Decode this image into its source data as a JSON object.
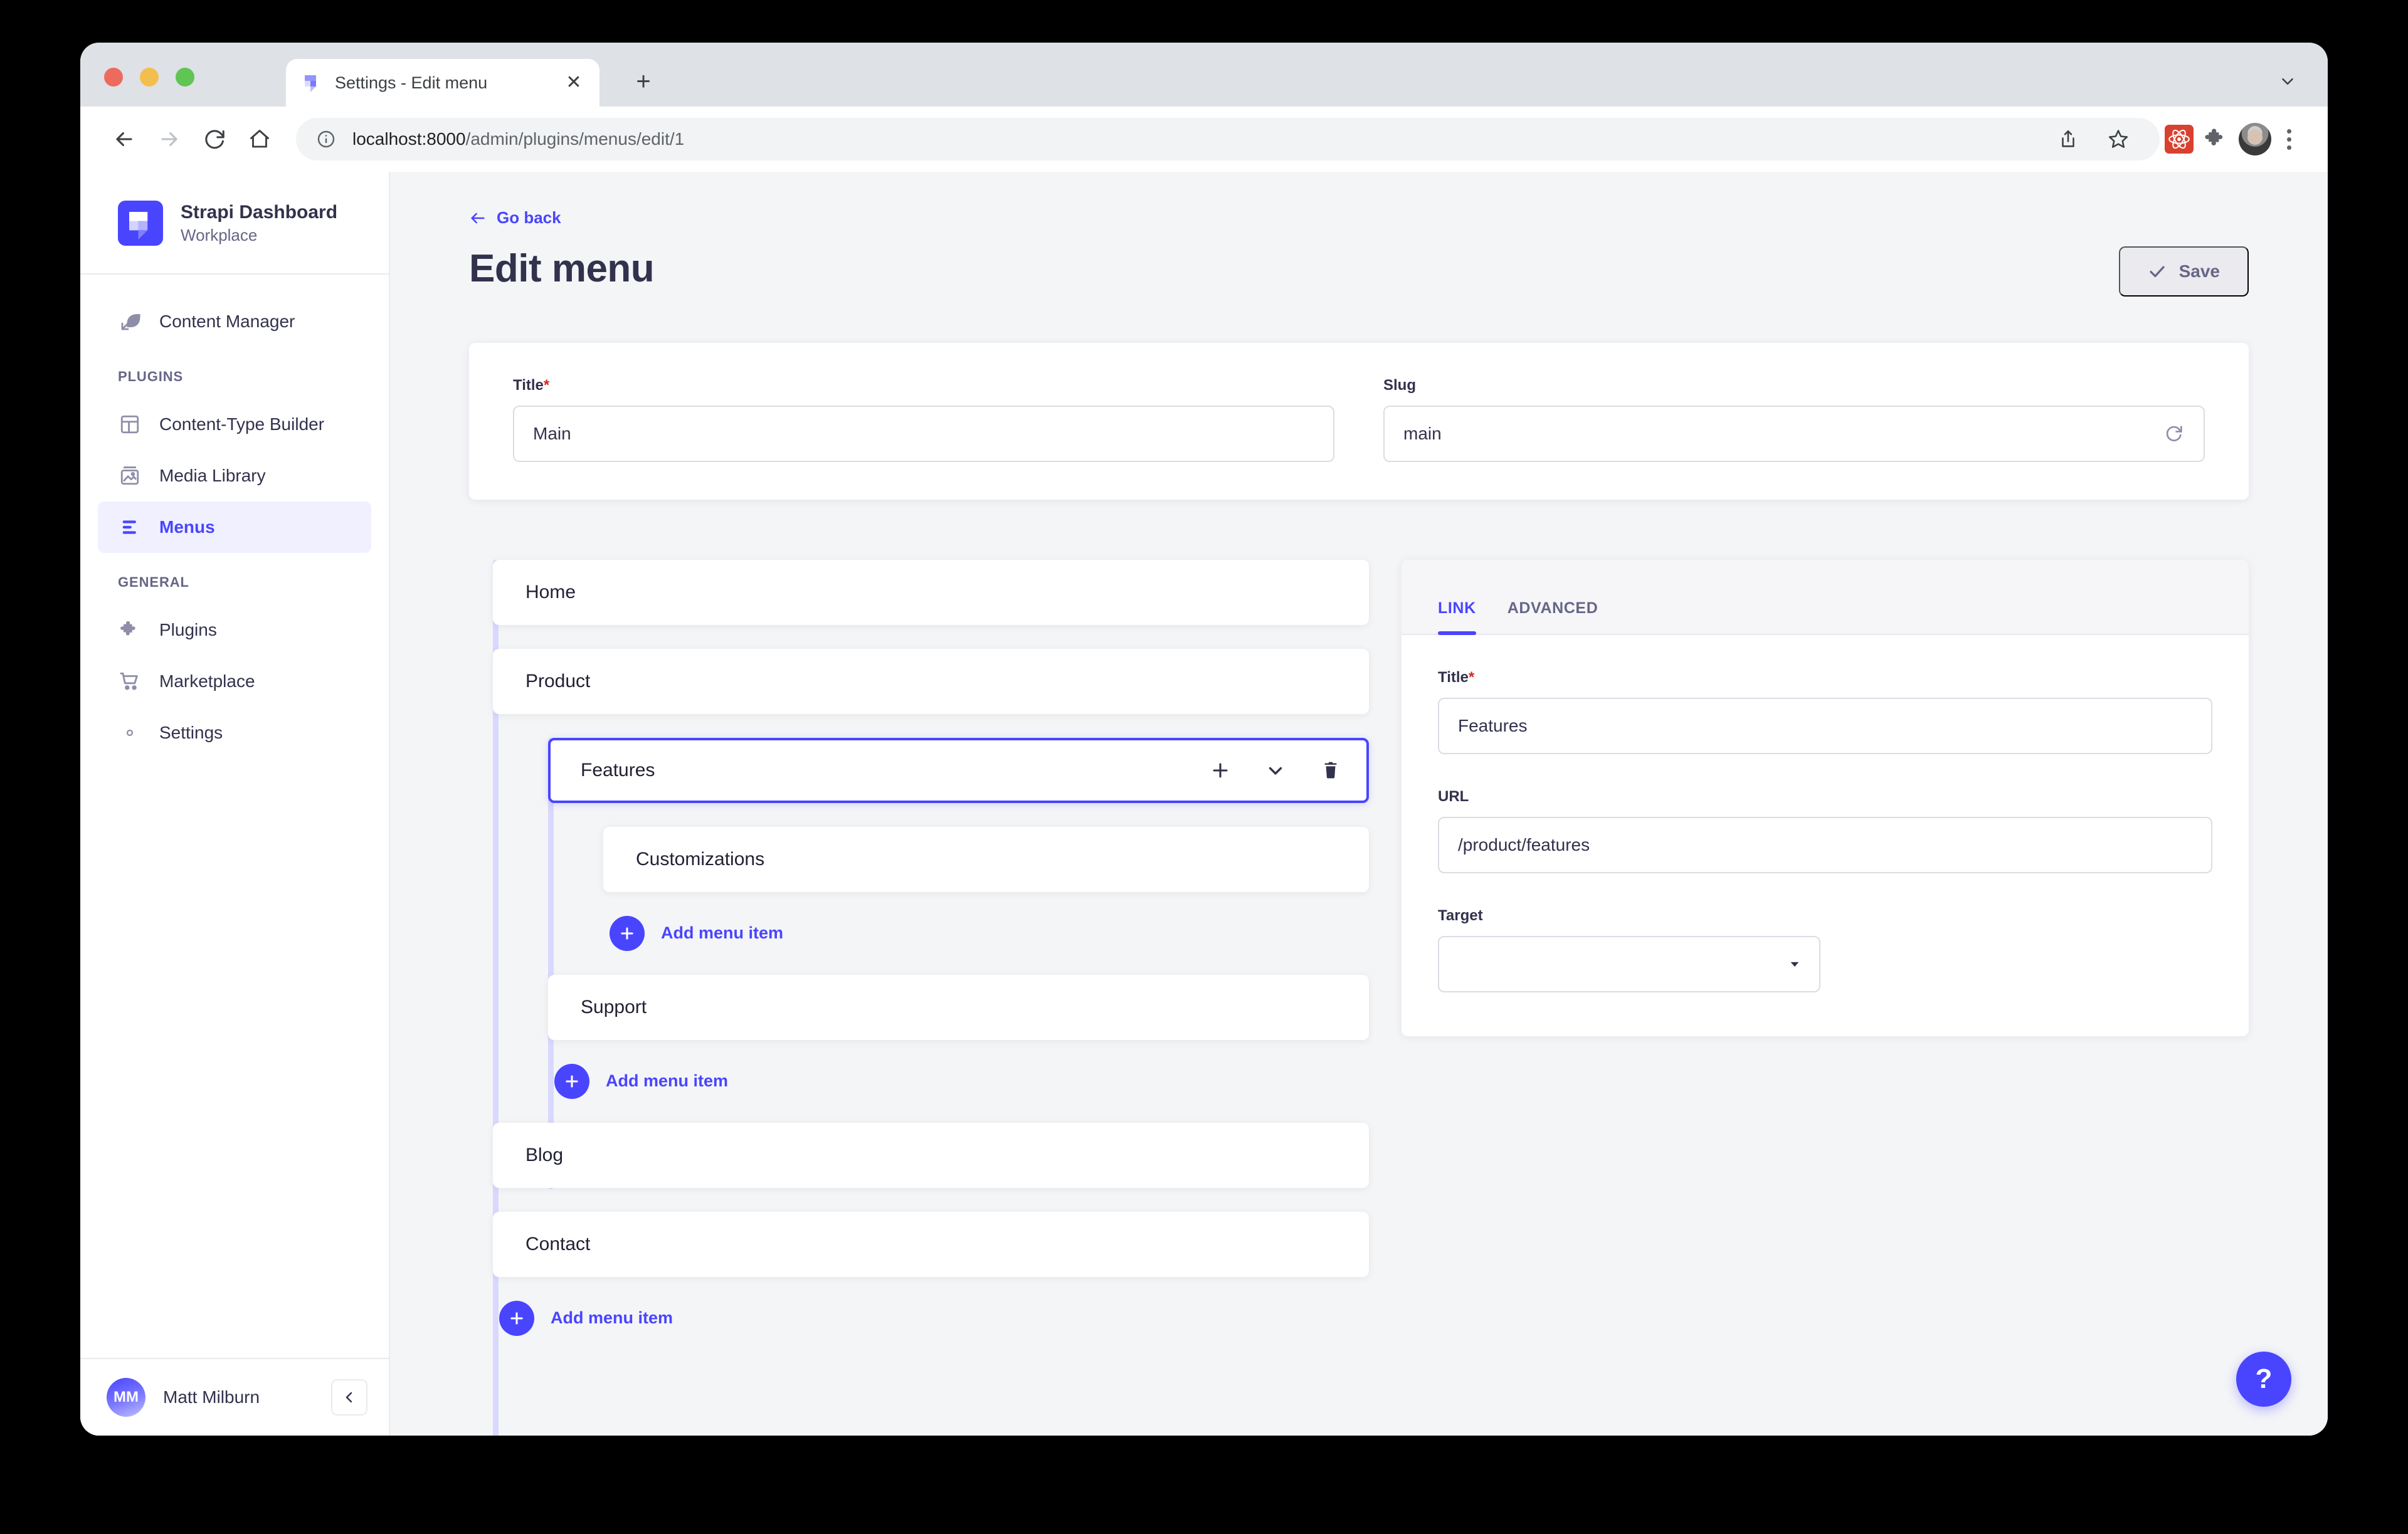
{
  "browser": {
    "tab_title": "Settings - Edit menu",
    "tab_favicon_icon": "strapi-logo-icon",
    "new_tab_icon": "plus-icon",
    "tab_list_chevron_icon": "chevron-down-icon",
    "back_icon": "arrow-left-icon",
    "forward_icon": "arrow-right-icon",
    "reload_icon": "reload-icon",
    "home_icon": "home-icon",
    "info_icon": "info-circle-icon",
    "url_host": "localhost:8000",
    "url_path": "/admin/plugins/menus/edit/1",
    "share_icon": "share-icon",
    "bookmark_icon": "star-icon",
    "extension_react_icon": "react-devtools-icon",
    "extensions_icon": "puzzle-piece-icon",
    "profile_icon": "profile-avatar-icon",
    "menu_icon": "three-dot-menu-icon"
  },
  "sidebar": {
    "brand_name": "Strapi Dashboard",
    "brand_subtitle": "Workplace",
    "brand_logo_icon": "strapi-logo-icon",
    "primary": [
      {
        "label": "Content Manager",
        "icon": "feather-pen-icon",
        "active": false
      }
    ],
    "groups": [
      {
        "label": "PLUGINS",
        "items": [
          {
            "label": "Content-Type Builder",
            "icon": "layout-grid-icon",
            "active": false
          },
          {
            "label": "Media Library",
            "icon": "image-icon",
            "active": false
          },
          {
            "label": "Menus",
            "icon": "menu-lines-icon",
            "active": true
          }
        ]
      },
      {
        "label": "GENERAL",
        "items": [
          {
            "label": "Plugins",
            "icon": "puzzle-piece-icon",
            "active": false
          },
          {
            "label": "Marketplace",
            "icon": "shopping-cart-icon",
            "active": false
          },
          {
            "label": "Settings",
            "icon": "gear-icon",
            "active": false
          }
        ]
      }
    ],
    "user": {
      "initials": "MM",
      "name": "Matt Milburn",
      "collapse_icon": "chevron-left-icon"
    }
  },
  "page": {
    "go_back_label": "Go back",
    "go_back_icon": "arrow-left-icon",
    "title": "Edit menu",
    "save_label": "Save",
    "save_icon": "check-icon",
    "save_disabled": true
  },
  "meta_form": {
    "title_label": "Title",
    "title_required": "*",
    "title_value": "Main",
    "slug_label": "Slug",
    "slug_value": "main",
    "slug_refresh_icon": "refresh-icon"
  },
  "menu_tree": {
    "items": [
      {
        "label": "Home",
        "depth": 0,
        "selected": false
      },
      {
        "label": "Product",
        "depth": 0,
        "selected": false
      },
      {
        "label": "Features",
        "depth": 1,
        "selected": true,
        "actions": [
          "plus-icon",
          "chevron-down-icon",
          "trash-icon"
        ]
      },
      {
        "label": "Customizations",
        "depth": 2,
        "selected": false
      },
      {
        "label": "__ADD__",
        "depth": 2,
        "selected": false
      },
      {
        "label": "Support",
        "depth": 1,
        "selected": false
      },
      {
        "label": "__ADD__",
        "depth": 1,
        "selected": false
      },
      {
        "label": "Blog",
        "depth": 0,
        "selected": false
      },
      {
        "label": "Contact",
        "depth": 0,
        "selected": false
      },
      {
        "label": "__ADD__",
        "depth": 0,
        "selected": false
      }
    ],
    "add_label": "Add menu item",
    "add_icon": "plus-icon"
  },
  "link_panel": {
    "tabs": [
      {
        "label": "LINK",
        "active": true
      },
      {
        "label": "ADVANCED",
        "active": false
      }
    ],
    "title_label": "Title",
    "title_required": "*",
    "title_value": "Features",
    "url_label": "URL",
    "url_value": "/product/features",
    "target_label": "Target",
    "target_value": "",
    "target_caret_icon": "chevron-down-icon"
  },
  "help": {
    "label": "?",
    "icon": "question-mark-icon"
  },
  "colors": {
    "accent": "#4945ff",
    "accent_light": "#f0f0ff",
    "tree_line": "#d9d8ff",
    "text_primary": "#32324d",
    "text_secondary": "#666687",
    "background": "#f4f5f7",
    "required": "#d02b20",
    "border": "#dcdce4"
  }
}
